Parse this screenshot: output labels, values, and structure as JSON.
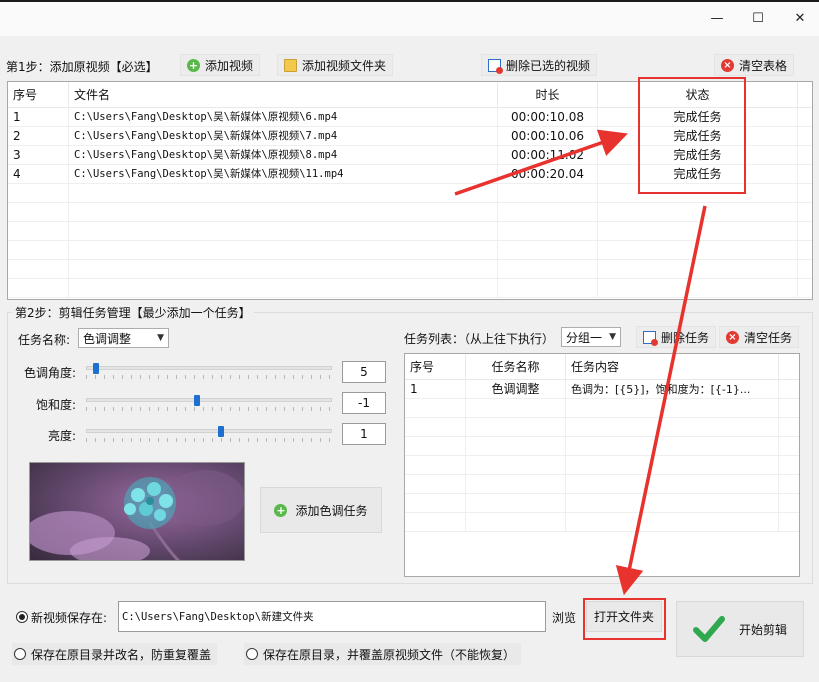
{
  "window": {
    "minimize_glyph": "—",
    "maximize_glyph": "☐",
    "close_glyph": "✕"
  },
  "step1": {
    "title": "第1步：添加原视频【必选】",
    "add_video": "添加视频",
    "add_folder": "添加视频文件夹",
    "delete_selected": "删除已选的视频",
    "clear_table": "清空表格"
  },
  "video_table": {
    "headers": [
      "序号",
      "文件名",
      "时长",
      "状态"
    ],
    "rows": [
      [
        "1",
        "C:\\Users\\Fang\\Desktop\\吴\\新媒体\\原视频\\6.mp4",
        "00:00:10.08",
        "完成任务"
      ],
      [
        "2",
        "C:\\Users\\Fang\\Desktop\\吴\\新媒体\\原视频\\7.mp4",
        "00:00:10.06",
        "完成任务"
      ],
      [
        "3",
        "C:\\Users\\Fang\\Desktop\\吴\\新媒体\\原视频\\8.mp4",
        "00:00:11.02",
        "完成任务"
      ],
      [
        "4",
        "C:\\Users\\Fang\\Desktop\\吴\\新媒体\\原视频\\11.mp4",
        "00:00:20.04",
        "完成任务"
      ]
    ]
  },
  "step2": {
    "title": "第2步：剪辑任务管理【最少添加一个任务】",
    "task_name_label": "任务名称:",
    "task_name_value": "色调调整",
    "hue_label": "色调角度:",
    "hue_value": "5",
    "hue_level": 0.03,
    "saturation_label": "饱和度:",
    "saturation_value": "-1",
    "saturation_level": 0.45,
    "brightness_label": "亮度:",
    "brightness_value": "1",
    "brightness_level": 0.55,
    "add_task": "添加色调任务",
    "task_list_label": "任务列表：（从上往下执行）",
    "group_value": "分组一",
    "delete_task": "删除任务",
    "clear_tasks": "清空任务"
  },
  "task_table": {
    "headers": [
      "序号",
      "任务名称",
      "任务内容"
    ],
    "rows": [
      [
        "1",
        "色调调整",
        "色调为：[{5}]，饱和度为：[{-1}..."
      ]
    ]
  },
  "output": {
    "new_location_label": "新视频保存在:",
    "path": "C:\\Users\\Fang\\Desktop\\新建文件夹",
    "browse": "浏览",
    "open_folder": "打开文件夹",
    "start": "开始剪辑",
    "option_rename": "保存在原目录并改名，防重复覆盖",
    "option_overwrite": "保存在原目录，并覆盖原视频文件（不能恢复）"
  },
  "colors": {
    "highlight_red": "#e8322d",
    "accent_blue": "#1f6fd1",
    "check_green": "#2fa84f"
  }
}
